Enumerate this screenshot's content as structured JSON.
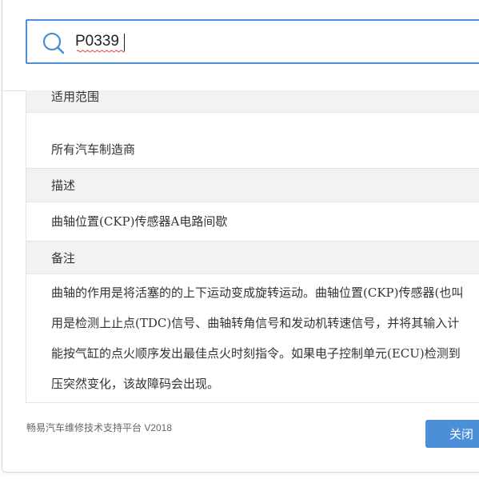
{
  "search": {
    "value": "P0339"
  },
  "table": {
    "rows": [
      {
        "kind": "header",
        "text": "适用范围"
      },
      {
        "kind": "body",
        "text": "所有汽车制造商"
      },
      {
        "kind": "header",
        "text": "描述"
      },
      {
        "kind": "body",
        "text": "曲轴位置(CKP)传感器A电路间歇"
      },
      {
        "kind": "header",
        "text": "备注"
      }
    ],
    "notes_lines": [
      "曲轴的作用是将活塞的的上下运动变成旋转运动。曲轴位置(CKP)传感器(也叫",
      "用是检测上止点(TDC)信号、曲轴转角信号和发动机转速信号，并将其输入计",
      "能按气缸的点火顺序发出最佳点火时刻指令。如果电子控制单元(ECU)检测到",
      "压突然变化，该故障码会出现。"
    ]
  },
  "footer": {
    "platform": "畅易汽车维修技术支持平台 V2018",
    "close_label": "关闭"
  },
  "colors": {
    "accent": "#4a8fd8",
    "header_bg": "#f2f2f2"
  }
}
